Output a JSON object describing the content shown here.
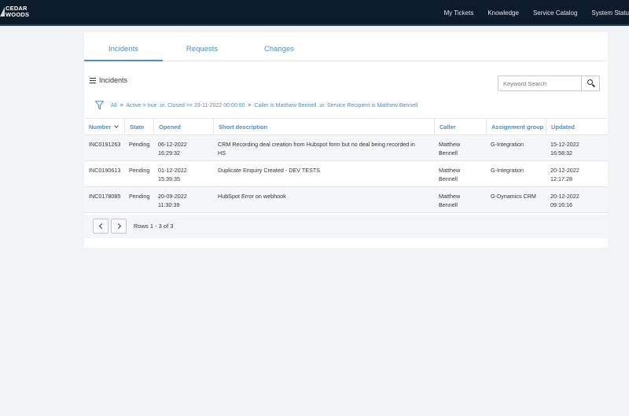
{
  "brand": {
    "line1": "CEDAR",
    "line2": "WOODS"
  },
  "nav": [
    "My Tickets",
    "Knowledge",
    "Service Catalog",
    "System Status"
  ],
  "tabs": [
    "Incidents",
    "Requests",
    "Changes"
  ],
  "active_tab": "Incidents",
  "list": {
    "title": "Incidents",
    "search_placeholder": "Keyword Search"
  },
  "breadcrumb": {
    "all": "All",
    "sep": ">",
    "filter1": "Active = true .or. Closed >= 23-11-2022 00:00:00",
    "filter2": "Caller is Matthew Bennell .or. Service Recipient is Matthew Bennell"
  },
  "table": {
    "columns": [
      "Number",
      "State",
      "Opened",
      "Short description",
      "Caller",
      "Assignment group",
      "Updated"
    ],
    "rows": [
      {
        "number": "INC0191263",
        "state": "Pending",
        "opened_date": "06-12-2022",
        "opened_time": "16:29:32",
        "desc1": "CRM Recording deal creation from Hubspot form but no deal being recorded in",
        "desc2": "HS",
        "caller1": "Matthew",
        "caller2": "Bennell",
        "group": "G-Integration",
        "updated_date": "15-12-2022",
        "updated_time": "16:58:32"
      },
      {
        "number": "INC0190613",
        "state": "Pending",
        "opened_date": "01-12-2022",
        "opened_time": "15:39:35",
        "desc1": "Duplicate Enquiry Created - DEV TESTS",
        "desc2": "",
        "caller1": "Matthew",
        "caller2": "Bennell",
        "group": "G-Integration",
        "updated_date": "20-12-2022",
        "updated_time": "12:17:28"
      },
      {
        "number": "INC0178085",
        "state": "Pending",
        "opened_date": "20-09-2022",
        "opened_time": "11:30:39",
        "desc1": "HubSpot Error on webhook",
        "desc2": "",
        "caller1": "Matthew",
        "caller2": "Bennell",
        "group": "G-Dynamics CRM",
        "updated_date": "20-12-2022",
        "updated_time": "09:16:16"
      }
    ]
  },
  "pager": {
    "rows_info": "Rows 1 - 3 of 3"
  },
  "colors": {
    "navbar": "#0d1c2b",
    "accent": "#4a90c2",
    "background": "#f1f3f4"
  }
}
